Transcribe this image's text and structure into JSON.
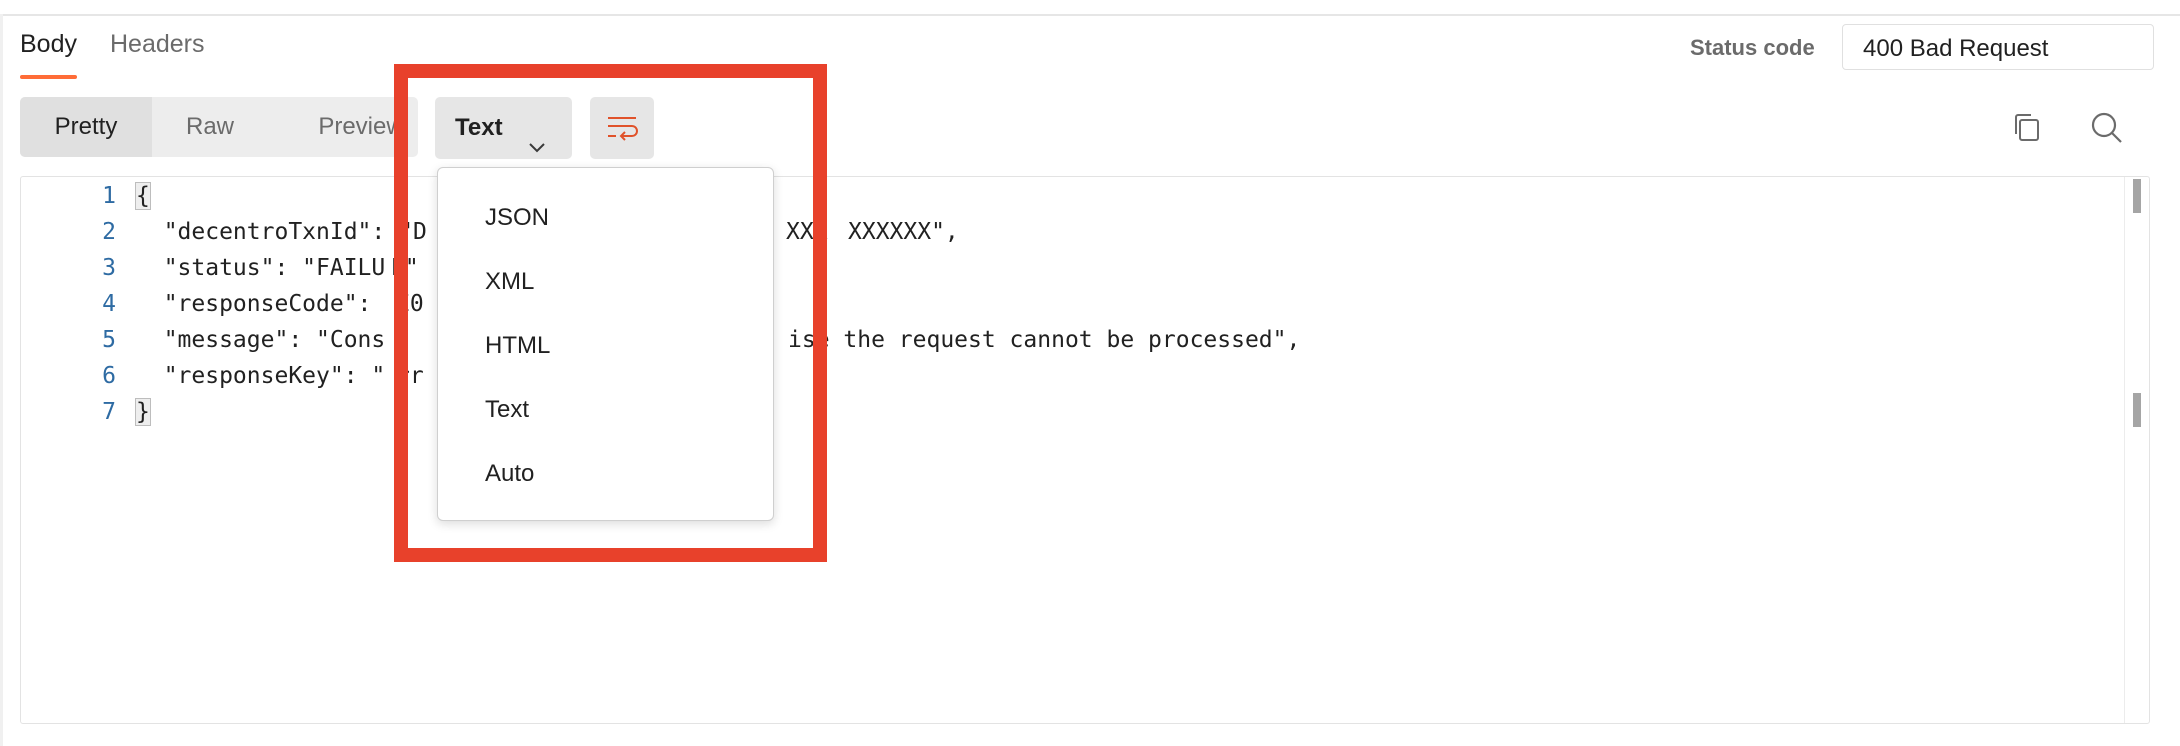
{
  "tabs": [
    {
      "label": "Body",
      "active": true
    },
    {
      "label": "Headers",
      "active": false
    }
  ],
  "status": {
    "label": "Status code",
    "value": "400 Bad Request"
  },
  "view_modes": [
    {
      "label": "Pretty",
      "active": true
    },
    {
      "label": "Raw",
      "active": false
    },
    {
      "label": "Preview",
      "active": false
    }
  ],
  "format_selector": {
    "selected": "Text",
    "icon": "chevron-down-icon"
  },
  "wrap_button": {
    "icon": "wrap-lines-icon"
  },
  "toolbar_icons": [
    "copy-icon",
    "search-icon"
  ],
  "editor": {
    "line_numbers": [
      "1",
      "2",
      "3",
      "4",
      "5",
      "6",
      "7"
    ],
    "lines": [
      "{",
      "  \"decentroTxnId\": \"D",
      "  \"status\": \"FAILU",
      "  \"responseCode\": ",
      "  \"message\": \"Cons",
      "  \"responseKey\": \"",
      "}"
    ],
    "overflow_fragments": {
      "line2": "XXX",
      "line2_tail": "XXXXXX\",",
      "line3": "E\"",
      "line4": "E0",
      "line5": "ise the request cannot be processed\",",
      "line6": "rr"
    }
  },
  "dropdown": {
    "options": [
      "JSON",
      "XML",
      "HTML",
      "Text",
      "Auto"
    ]
  },
  "colors": {
    "accent": "#ff6c37",
    "highlight_border": "#e8412b",
    "line_number": "#2e6ba3"
  }
}
